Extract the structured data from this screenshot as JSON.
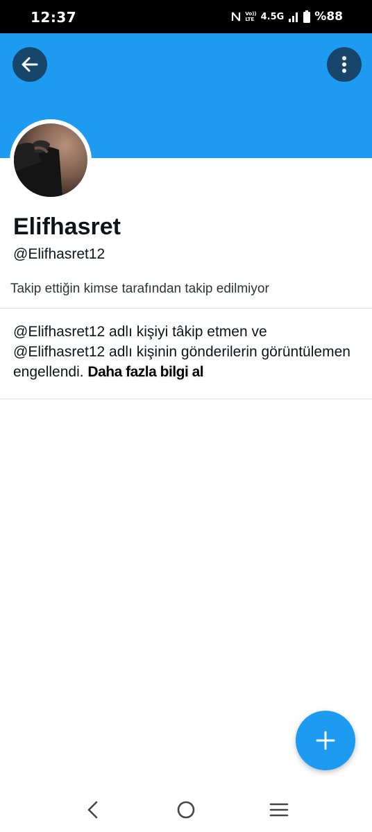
{
  "status_bar": {
    "time": "12:37",
    "volte_top": "Vo))",
    "volte_bottom": "LTE",
    "network": "4.5G",
    "battery": "%88",
    "icons": [
      "nfc-icon",
      "signal-icon",
      "battery-icon"
    ]
  },
  "header": {
    "back_icon": "arrow-left-icon",
    "more_icon": "more-vertical-icon",
    "banner_color": "#1d9bf0"
  },
  "profile": {
    "display_name": "Elifhasret",
    "handle": "@Elifhasret12",
    "follow_note": "Takip ettiğin kimse tarafından takip edilmiyor"
  },
  "block_notice": {
    "text": "@Elifhasret12 adlı kişiyi tâkip etmen ve @Elifhasret12 adlı kişinin gönderilerin görüntülemen engellendi. ",
    "link": "Daha fazla bilgi al"
  },
  "fab": {
    "icon": "plus-icon",
    "color": "#1d9bf0"
  },
  "nav_bar": {
    "icons": [
      "nav-back-icon",
      "nav-home-icon",
      "nav-recents-icon"
    ]
  }
}
